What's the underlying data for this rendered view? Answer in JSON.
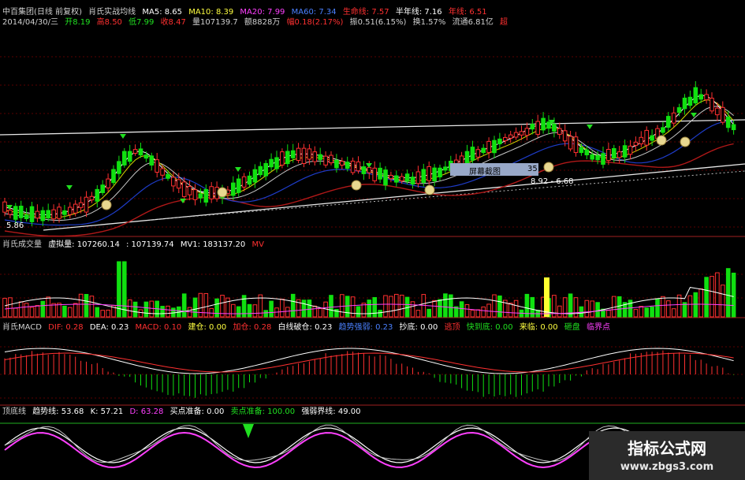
{
  "header": {
    "line1": [
      {
        "text": "中百集团(日线 前复权)",
        "color": "#d0d0d0"
      },
      {
        "text": "肖氏实战均线",
        "color": "#d0d0d0"
      },
      {
        "text": "MA5: 8.65",
        "color": "#ffffff"
      },
      {
        "text": "MA10: 8.39",
        "color": "#ffff40"
      },
      {
        "text": "MA20: 7.99",
        "color": "#ff40ff"
      },
      {
        "text": "MA60: 7.34",
        "color": "#4a80ff"
      },
      {
        "text": "生命线: 7.57",
        "color": "#ff3030"
      },
      {
        "text": "半年线: 7.16",
        "color": "#ffffff"
      },
      {
        "text": "年线: 6.51",
        "color": "#ff3030"
      }
    ],
    "line2": [
      {
        "text": "2014/04/30/三",
        "color": "#d0d0d0"
      },
      {
        "text": "开8.19",
        "color": "#20e020"
      },
      {
        "text": "高8.50",
        "color": "#ff3030"
      },
      {
        "text": "低7.99",
        "color": "#20e020"
      },
      {
        "text": "收8.47",
        "color": "#ff3030"
      },
      {
        "text": "量107139.7",
        "color": "#d0d0d0"
      },
      {
        "text": "额8828万",
        "color": "#d0d0d0"
      },
      {
        "text": "幅0.18(2.17%)",
        "color": "#ff3030"
      },
      {
        "text": "振0.51(6.15%)",
        "color": "#d0d0d0"
      },
      {
        "text": "换1.57%",
        "color": "#d0d0d0"
      },
      {
        "text": "流通6.81亿",
        "color": "#d0d0d0"
      },
      {
        "text": "超",
        "color": "#ff3030"
      }
    ]
  },
  "volume_panel": {
    "labels": [
      {
        "text": "肖氏成交量",
        "color": "#d0d0d0"
      },
      {
        "text": "虚拟量: 107260.14",
        "color": "#ffffff"
      },
      {
        "text": ": 107139.74",
        "color": "#ffffff"
      },
      {
        "text": "MV1: 183137.20",
        "color": "#ffffff"
      },
      {
        "text": "MV",
        "color": "#ff3030"
      }
    ]
  },
  "macd_panel": {
    "labels": [
      {
        "text": "肖氏MACD",
        "color": "#d0d0d0"
      },
      {
        "text": "DIF: 0.28",
        "color": "#ff3030"
      },
      {
        "text": "DEA: 0.23",
        "color": "#ffffff"
      },
      {
        "text": "MACD: 0.10",
        "color": "#ff3030"
      },
      {
        "text": "建仓: 0.00",
        "color": "#ffff40"
      },
      {
        "text": "加仓: 0.28",
        "color": "#ff3030"
      },
      {
        "text": "白线破仓: 0.23",
        "color": "#ffffff"
      },
      {
        "text": "趋势强弱: 0.23",
        "color": "#4a80ff"
      },
      {
        "text": "抄底: 0.00",
        "color": "#ffffff"
      },
      {
        "text": "逃顶",
        "color": "#ff3030"
      },
      {
        "text": "快到底: 0.00",
        "color": "#20e020"
      },
      {
        "text": "来临: 0.00",
        "color": "#ffff40"
      },
      {
        "text": "砸盘",
        "color": "#20e020"
      },
      {
        "text": "临界点",
        "color": "#ff40ff"
      }
    ]
  },
  "kdj_panel": {
    "labels": [
      {
        "text": "顶底线",
        "color": "#d0d0d0"
      },
      {
        "text": "趋势线: 53.68",
        "color": "#ffffff"
      },
      {
        "text": "K: 57.21",
        "color": "#ffffff"
      },
      {
        "text": "D: 63.28",
        "color": "#ff40ff"
      },
      {
        "text": "买点准备: 0.00",
        "color": "#ffffff"
      },
      {
        "text": "卖点准备: 100.00",
        "color": "#20e020"
      },
      {
        "text": "强弱界线: 49.00",
        "color": "#ffffff"
      }
    ]
  },
  "tooltip": {
    "text": "屏幕截图",
    "value": "35"
  },
  "price_labels": [
    {
      "text": "5.86",
      "color": "#ffffff"
    },
    {
      "text": "8.92 - 6.68",
      "color": "#ffffff"
    }
  ],
  "watermark": {
    "title": "指标公式网",
    "url": "www.zbgs3.com"
  }
}
